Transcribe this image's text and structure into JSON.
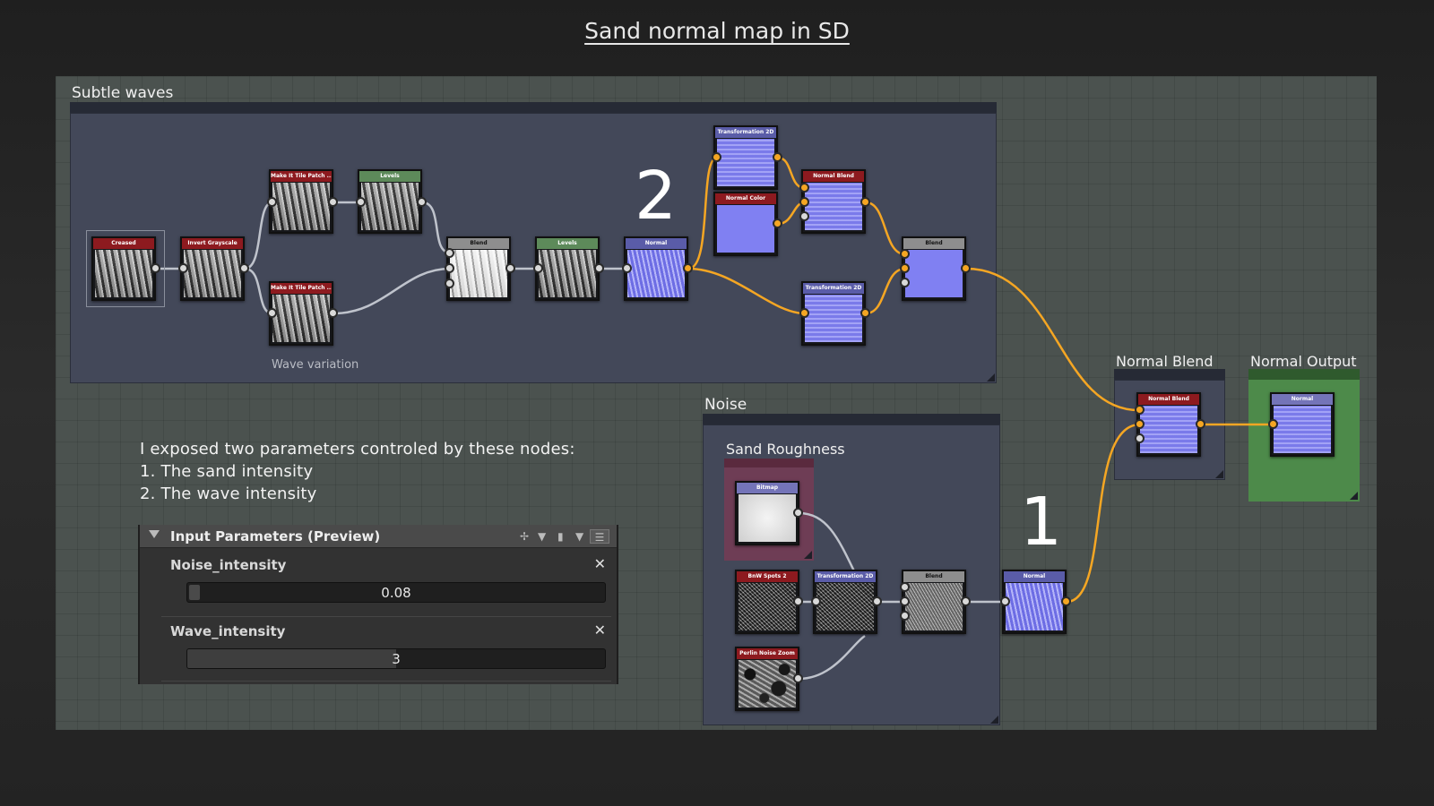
{
  "title": "Sand normal map in SD",
  "frames": {
    "subtle_waves": "Subtle waves",
    "noise": "Noise",
    "sand_roughness": "Sand Roughness",
    "normal_blend": "Normal Blend",
    "normal_output": "Normal Output"
  },
  "wave_variation_label": "Wave variation",
  "markers": {
    "one": "1",
    "two": "2"
  },
  "note": {
    "line1": "I exposed two parameters controled by these nodes:",
    "line2": "1. The sand intensity",
    "line3": "2. The wave intensity"
  },
  "nodes": {
    "creased": "Creased",
    "invert_grayscale": "Invert Grayscale",
    "make_tile_1": "Make It Tile Patch ...",
    "make_tile_2": "Make It Tile Patch ...",
    "levels_1": "Levels",
    "blend_1": "Blend",
    "levels_2": "Levels",
    "normal_1": "Normal",
    "transformation_1": "Transformation 2D",
    "normal_color": "Normal Color",
    "normal_blend_1": "Normal Blend",
    "transformation_2": "Transformation 2D",
    "blend_2": "Blend",
    "bitmap": "Bitmap",
    "bnw_spots": "BnW Spots 2",
    "transformation_3": "Transformation 2D",
    "blend_3": "Blend",
    "perlin_zoom": "Perlin Noise Zoom",
    "normal_2": "Normal",
    "normal_blend_2": "Normal Blend",
    "output_normal": "Normal"
  },
  "panel": {
    "title": "Input Parameters (Preview)",
    "params": [
      {
        "label": "Noise_intensity",
        "value": "0.08",
        "fraction": 0.0
      },
      {
        "label": "Wave_intensity",
        "value": "3",
        "fraction": 0.5
      }
    ],
    "icons": [
      "pin-icon",
      "dropdown-icon",
      "page-icon",
      "dropdown-icon",
      "list-icon"
    ]
  },
  "colors": {
    "wire_orange": "#f5a623",
    "wire_gray": "#bfc3cc",
    "frame_bg": "#434859",
    "output_green": "#4d8a4a"
  }
}
